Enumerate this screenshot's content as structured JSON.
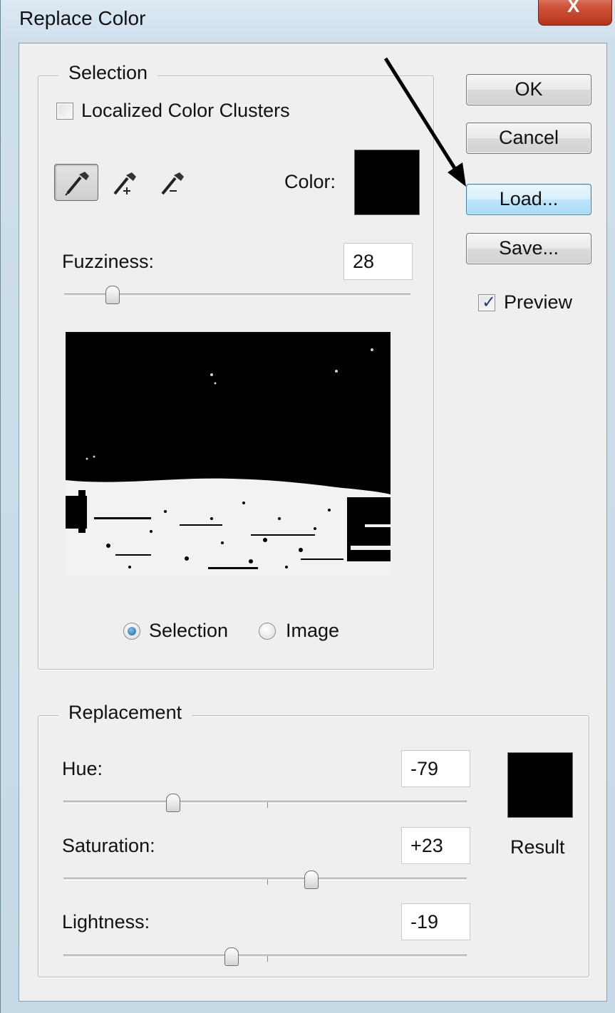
{
  "window": {
    "title": "Replace Color",
    "close_glyph": "X"
  },
  "buttons": {
    "ok": "OK",
    "cancel": "Cancel",
    "load": "Load...",
    "save": "Save..."
  },
  "preview": {
    "label": "Preview",
    "checked": true
  },
  "selection": {
    "group_title": "Selection",
    "localized_color_clusters": {
      "label": "Localized Color Clusters",
      "checked": false
    },
    "tools": [
      "eyedropper-icon",
      "eyedropper-plus-icon",
      "eyedropper-minus-icon"
    ],
    "color_label": "Color:",
    "color_value": "#000000",
    "fuzziness": {
      "label": "Fuzziness:",
      "value": "28",
      "slider_fraction": 0.14
    },
    "view_options": {
      "selection": "Selection",
      "image": "Image",
      "selected": "selection"
    }
  },
  "replacement": {
    "group_title": "Replacement",
    "hue": {
      "label": "Hue:",
      "value": "-79",
      "slider_value": -79,
      "range": [
        -180,
        180
      ]
    },
    "saturation": {
      "label": "Saturation:",
      "value": "+23",
      "slider_value": 23,
      "range": [
        -100,
        100
      ]
    },
    "lightness": {
      "label": "Lightness:",
      "value": "-19",
      "slider_value": -19,
      "range": [
        -100,
        100
      ]
    },
    "result_label": "Result",
    "result_color": "#000000"
  }
}
